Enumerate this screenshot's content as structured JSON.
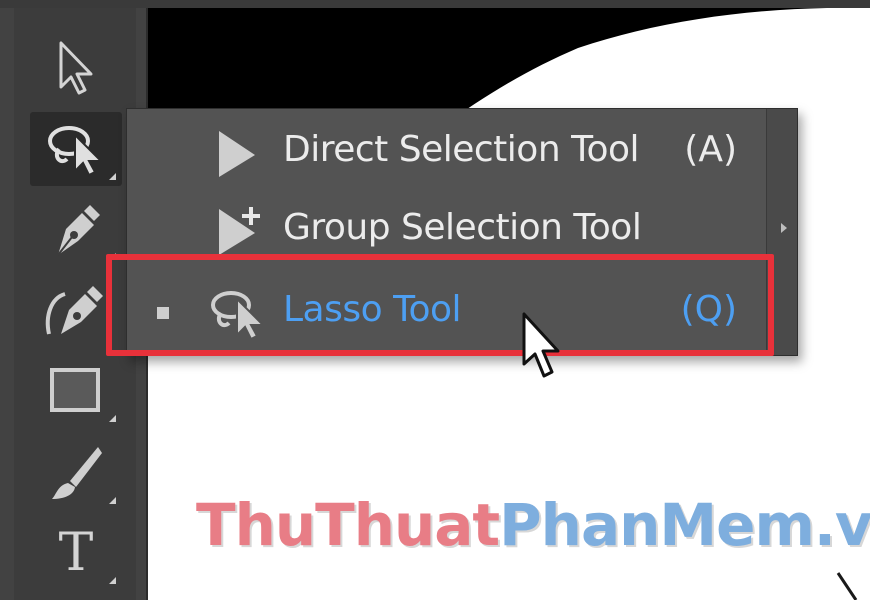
{
  "toolbar": {
    "tools": [
      {
        "icon": "selection-arrow-icon",
        "has_submenu": false
      },
      {
        "icon": "lasso-icon",
        "has_submenu": true,
        "active": true
      },
      {
        "icon": "pen-icon",
        "has_submenu": true
      },
      {
        "icon": "curvature-pen-icon",
        "has_submenu": false
      },
      {
        "icon": "rectangle-icon",
        "has_submenu": true
      },
      {
        "icon": "paintbrush-icon",
        "has_submenu": true
      },
      {
        "icon": "type-icon",
        "has_submenu": true
      }
    ],
    "type_tool_glyph": "T"
  },
  "flyout": {
    "items": [
      {
        "label": "Direct Selection Tool",
        "shortcut": "(A)",
        "icon": "direct-selection-icon",
        "current": false
      },
      {
        "label": "Group Selection Tool",
        "shortcut": "",
        "icon": "group-selection-icon",
        "current": false
      },
      {
        "label": "Lasso Tool",
        "shortcut": "(Q)",
        "icon": "lasso-icon",
        "current": true
      }
    ]
  },
  "watermark": {
    "part1": "ThuThuat",
    "part2": "PhanMem.vn"
  },
  "colors": {
    "highlight": "#e8313a",
    "active_item_text": "#4d9ff2",
    "menu_bg": "#535353",
    "toolbar_bg": "#424242"
  }
}
